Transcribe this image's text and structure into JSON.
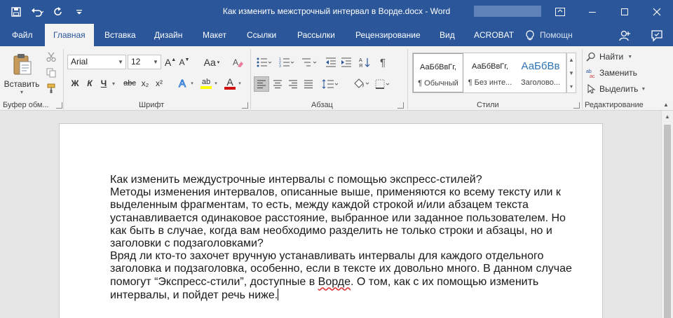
{
  "titlebar": {
    "title": "Как изменить межстрочный интервал в Ворде.docx - Word",
    "qat": [
      "save-icon",
      "undo-icon",
      "redo-icon",
      "customize-qat-icon"
    ],
    "window_controls": [
      "ribbon-display-options-icon",
      "minimize-icon",
      "maximize-icon",
      "close-icon"
    ]
  },
  "tabs": {
    "items": [
      "Файл",
      "Главная",
      "Вставка",
      "Дизайн",
      "Макет",
      "Ссылки",
      "Рассылки",
      "Рецензирование",
      "Вид",
      "ACROBAT"
    ],
    "active": "Главная",
    "help": "Помощн",
    "right_icons": [
      "share-icon",
      "feedback-icon"
    ]
  },
  "ribbon": {
    "clipboard": {
      "paste_label": "Вставить",
      "group_label": "Буфер обм..."
    },
    "font": {
      "font_name": "Arial",
      "font_size": "12",
      "grow": "A",
      "shrink": "A",
      "case": "Aa",
      "bold": "Ж",
      "italic": "К",
      "underline": "Ч",
      "strike": "abc",
      "subscript": "x₂",
      "superscript": "x²",
      "text_effects": "A",
      "highlight": "ab",
      "font_color": "A",
      "group_label": "Шрифт"
    },
    "paragraph": {
      "group_label": "Абзац"
    },
    "styles": {
      "items": [
        {
          "sample": "АаБбВвГг,",
          "name": "¶ Обычный"
        },
        {
          "sample": "АаБбВвГг,",
          "name": "¶ Без инте..."
        },
        {
          "sample": "АаБбВв",
          "name": "Заголово..."
        }
      ],
      "group_label": "Стили"
    },
    "editing": {
      "find": "Найти",
      "replace": "Заменить",
      "select": "Выделить",
      "group_label": "Редактирование"
    }
  },
  "document": {
    "lines": [
      "Как изменить междустрочные интервалы с помощью экспресс-стилей?",
      "Методы изменения интервалов, описанные выше, применяются ко всему тексту или к",
      "выделенным фрагментам, то есть, между каждой строкой и/или абзацем текста",
      "устанавливается одинаковое расстояние, выбранное или заданное пользователем. Но",
      "как быть в случае, когда вам необходимо разделить не только строки и абзацы, но и",
      "заголовки с подзаголовками?",
      "Вряд ли кто-то захочет вручную устанавливать интервалы для каждого отдельного",
      "заголовка и подзаголовка, особенно, если в тексте их довольно много. В данном случае",
      "помогут “Экспресс-стили”, доступные в ",
      "интервалы, и пойдет речь ниже."
    ],
    "line9_misspelled": "Ворде",
    "line9_rest": ". О том, как с их помощью изменить"
  },
  "colors": {
    "accent": "#2b579a",
    "ribbon_bg": "#f3f3f3",
    "doc_bg": "#e6e6e6"
  }
}
